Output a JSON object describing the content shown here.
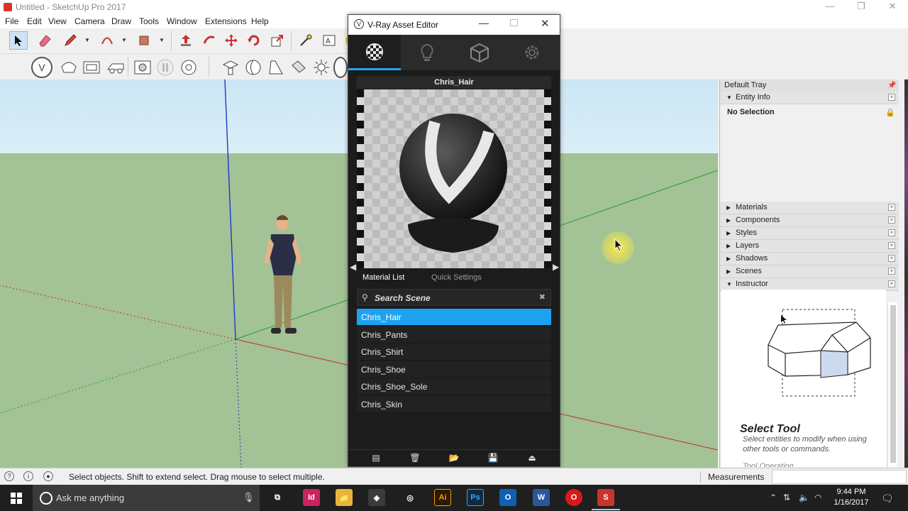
{
  "window": {
    "title": "Untitled - SketchUp Pro 2017",
    "controls": [
      "—",
      "❐",
      "✕"
    ]
  },
  "menu": [
    "File",
    "Edit",
    "View",
    "Camera",
    "Draw",
    "Tools",
    "Window",
    "Extensions",
    "Help"
  ],
  "toolbar_icons": [
    "select-icon",
    "eraser-icon",
    "pencil-icon",
    "arc-icon",
    "rectangle-icon",
    "push-pull-icon",
    "follow-me-icon",
    "move-icon",
    "rotate-icon",
    "scale-icon",
    "tape-measure-icon",
    "dimension-icon"
  ],
  "vray_editor": {
    "title": "V-Ray Asset Editor",
    "tabs": [
      "materials-icon",
      "lights-icon",
      "geometry-icon",
      "settings-icon"
    ],
    "active_tab": 0,
    "preview_title": "Chris_Hair",
    "subtabs": {
      "material_list": "Material List",
      "quick_settings": "Quick Settings"
    },
    "search_placeholder": "Search Scene",
    "materials": [
      "Chris_Hair",
      "Chris_Pants",
      "Chris_Shirt",
      "Chris_Shoe",
      "Chris_Shoe_Sole",
      "Chris_Skin"
    ],
    "selected_material": "Chris_Hair",
    "accent_color": "#1ca2f1",
    "bottom_actions": [
      "new-material-icon",
      "delete-icon",
      "open-file-icon",
      "save-icon",
      "import-icon"
    ]
  },
  "tray": {
    "title": "Default Tray",
    "entity_info": {
      "label": "Entity Info",
      "selection": "No Selection"
    },
    "panels": [
      "Materials",
      "Components",
      "Styles",
      "Layers",
      "Shadows",
      "Scenes",
      "Instructor"
    ],
    "instructor": {
      "heading": "Select Tool",
      "description": "Select entities to modify when using other tools or commands.",
      "next_section": "Tool Operation"
    }
  },
  "status_bar": {
    "text": "Select objects. Shift to extend select. Drag mouse to select multiple.",
    "measurements_label": "Measurements",
    "measurements_value": ""
  },
  "taskbar": {
    "search_placeholder": "Ask me anything",
    "apps": [
      {
        "name": "task-view",
        "label": "⧉",
        "color": "#1f1f1f"
      },
      {
        "name": "indesign",
        "label": "Id",
        "color": "#c8245f"
      },
      {
        "name": "file-explorer",
        "label": "📁",
        "color": "#e8b43a"
      },
      {
        "name": "app-3d",
        "label": "◈",
        "color": "#3b3b3b"
      },
      {
        "name": "chrome",
        "label": "◎",
        "color": "#1f1f1f"
      },
      {
        "name": "illustrator",
        "label": "Ai",
        "color": "#2b1a00"
      },
      {
        "name": "photoshop",
        "label": "Ps",
        "color": "#0f2a44"
      },
      {
        "name": "outlook",
        "label": "O",
        "color": "#0f5fb3"
      },
      {
        "name": "word",
        "label": "W",
        "color": "#2b579a"
      },
      {
        "name": "opera",
        "label": "O",
        "color": "#d61a1a"
      },
      {
        "name": "sketchup",
        "label": "S",
        "color": "#c9342a"
      }
    ],
    "time": "9:44 PM",
    "date": "1/16/2017"
  }
}
